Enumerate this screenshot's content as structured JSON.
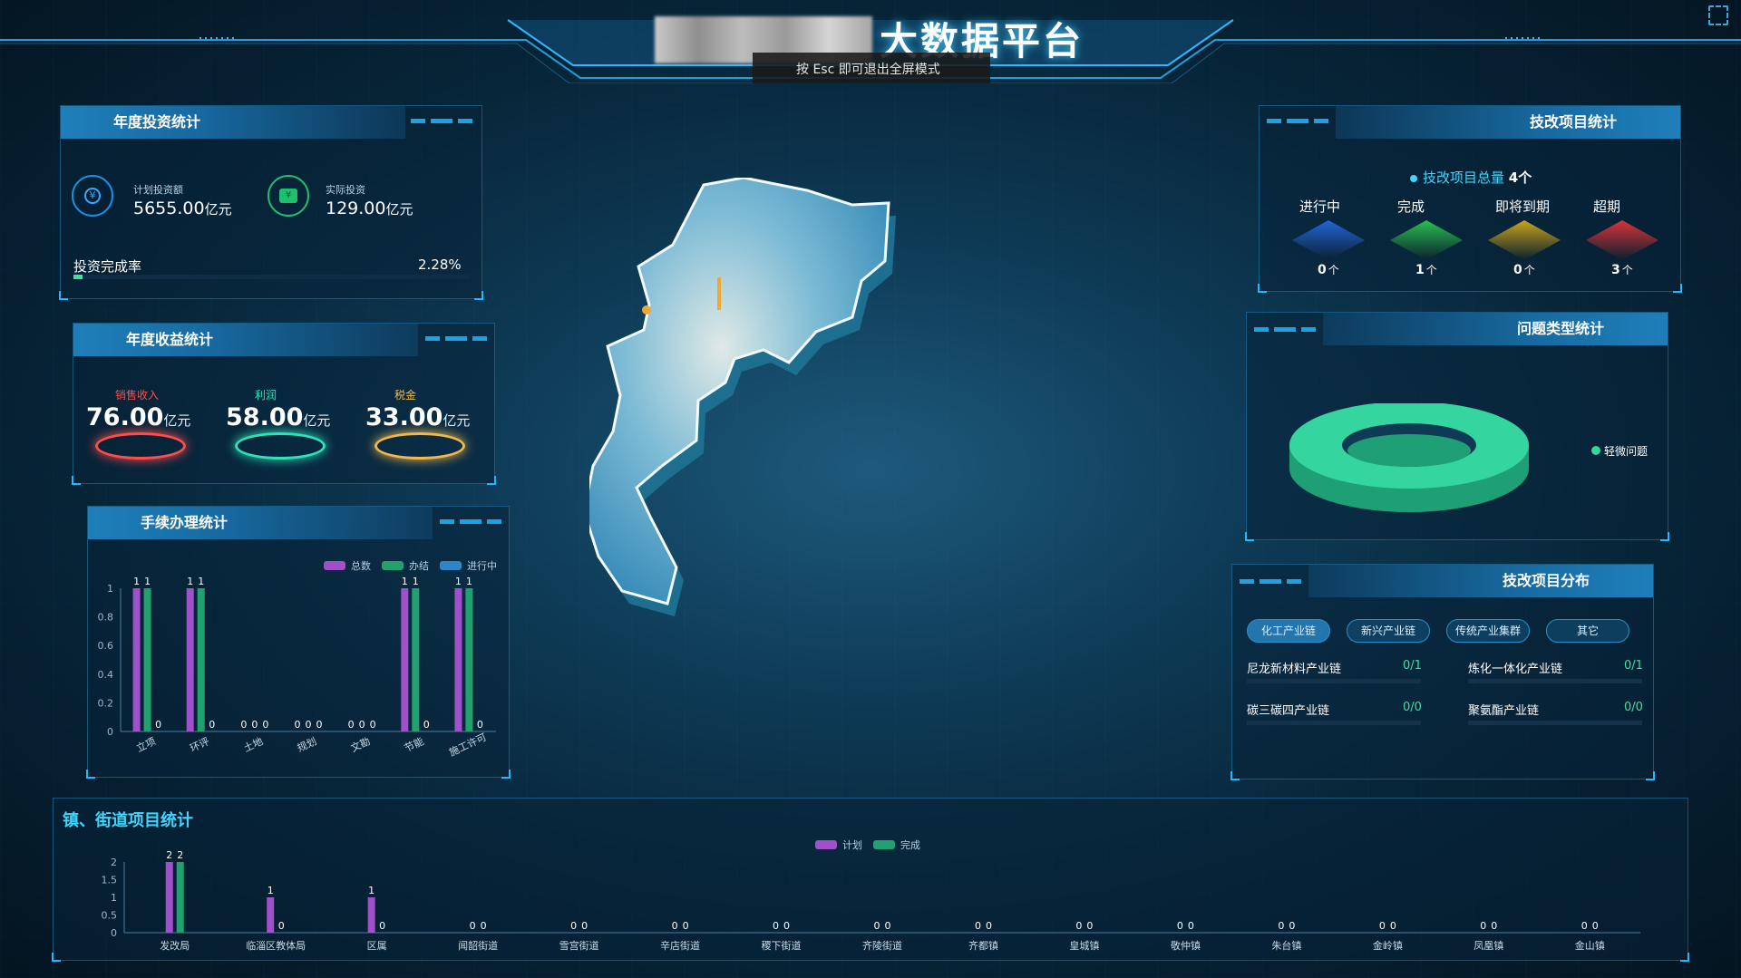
{
  "header": {
    "title": "大数据平台",
    "tooltip": "按 Esc 即可退出全屏模式"
  },
  "annual_investment": {
    "title": "年度投资统计",
    "planned_label": "计划投资额",
    "planned_value": "5655.00",
    "planned_unit": "亿元",
    "actual_label": "实际投资",
    "actual_value": "129.00",
    "actual_unit": "亿元",
    "rate_label": "投资完成率",
    "rate_value": "2.28%",
    "rate_fraction": 0.0228
  },
  "annual_revenue": {
    "title": "年度收益统计",
    "items": [
      {
        "label": "销售收入",
        "value": "76.00",
        "unit": "亿元",
        "color": "#ff4d4d"
      },
      {
        "label": "利润",
        "value": "58.00",
        "unit": "亿元",
        "color": "#2ee3b5"
      },
      {
        "label": "税金",
        "value": "33.00",
        "unit": "亿元",
        "color": "#f2b84b"
      }
    ]
  },
  "procedures": {
    "title": "手续办理统计"
  },
  "tech_projects": {
    "title": "技改项目统计",
    "total_label": "技改项目总量",
    "total_value": "4个",
    "statuses": [
      {
        "label": "进行中",
        "count": "0",
        "unit": "个",
        "icon": "hourglass-icon",
        "color": "#2266d8"
      },
      {
        "label": "完成",
        "count": "1",
        "unit": "个",
        "icon": "clipboard-check-icon",
        "color": "#2bbf4f"
      },
      {
        "label": "即将到期",
        "count": "0",
        "unit": "个",
        "icon": "warning-icon",
        "color": "#c9a51c"
      },
      {
        "label": "超期",
        "count": "3",
        "unit": "个",
        "icon": "alarm-icon",
        "color": "#d8343a"
      }
    ]
  },
  "problem_types": {
    "title": "问题类型统计",
    "legend": "轻微问题",
    "color": "#35d5a0"
  },
  "distribution": {
    "title": "技改项目分布",
    "tabs": [
      "化工产业链",
      "新兴产业链",
      "传统产业集群",
      "其它"
    ],
    "items": [
      {
        "name": "尼龙新材料产业链",
        "value": "0/1"
      },
      {
        "name": "炼化一体化产业链",
        "value": "0/1"
      },
      {
        "name": "碳三碳四产业链",
        "value": "0/0"
      },
      {
        "name": "聚氨酯产业链",
        "value": "0/0"
      }
    ]
  },
  "town_stats": {
    "title": "镇、街道项目统计"
  },
  "chart_data": [
    {
      "type": "bar",
      "title": "手续办理统计",
      "categories": [
        "立项",
        "环评",
        "土地",
        "规划",
        "文勘",
        "节能",
        "施工许可"
      ],
      "series": [
        {
          "name": "总数",
          "color": "#a050c8",
          "values": [
            1,
            1,
            0,
            0,
            0,
            1,
            1
          ]
        },
        {
          "name": "办结",
          "color": "#22a070",
          "values": [
            1,
            1,
            0,
            0,
            0,
            1,
            1
          ]
        },
        {
          "name": "进行中",
          "color": "#2f86c6",
          "values": [
            0,
            0,
            0,
            0,
            0,
            0,
            0
          ]
        }
      ],
      "ylim": [
        0,
        1
      ],
      "yticks": [
        "0",
        "0.2",
        "0.4",
        "0.6",
        "0.8",
        "1"
      ],
      "legend": "top-right"
    },
    {
      "type": "bar",
      "title": "镇、街道项目统计",
      "categories": [
        "发改局",
        "临淄区教体局",
        "区属",
        "闻韶街道",
        "雪宫街道",
        "辛店街道",
        "稷下街道",
        "齐陵街道",
        "齐都镇",
        "皇城镇",
        "敬仲镇",
        "朱台镇",
        "金岭镇",
        "凤凰镇",
        "金山镇"
      ],
      "series": [
        {
          "name": "计划",
          "color": "#a050c8",
          "values": [
            2,
            1,
            1,
            0,
            0,
            0,
            0,
            0,
            0,
            0,
            0,
            0,
            0,
            0,
            0
          ]
        },
        {
          "name": "完成",
          "color": "#22a070",
          "values": [
            2,
            0,
            0,
            0,
            0,
            0,
            0,
            0,
            0,
            0,
            0,
            0,
            0,
            0,
            0
          ]
        }
      ],
      "ylim": [
        0,
        2
      ],
      "yticks": [
        "0",
        "0.5",
        "1",
        "1.5",
        "2"
      ],
      "legend": "top-center"
    }
  ]
}
